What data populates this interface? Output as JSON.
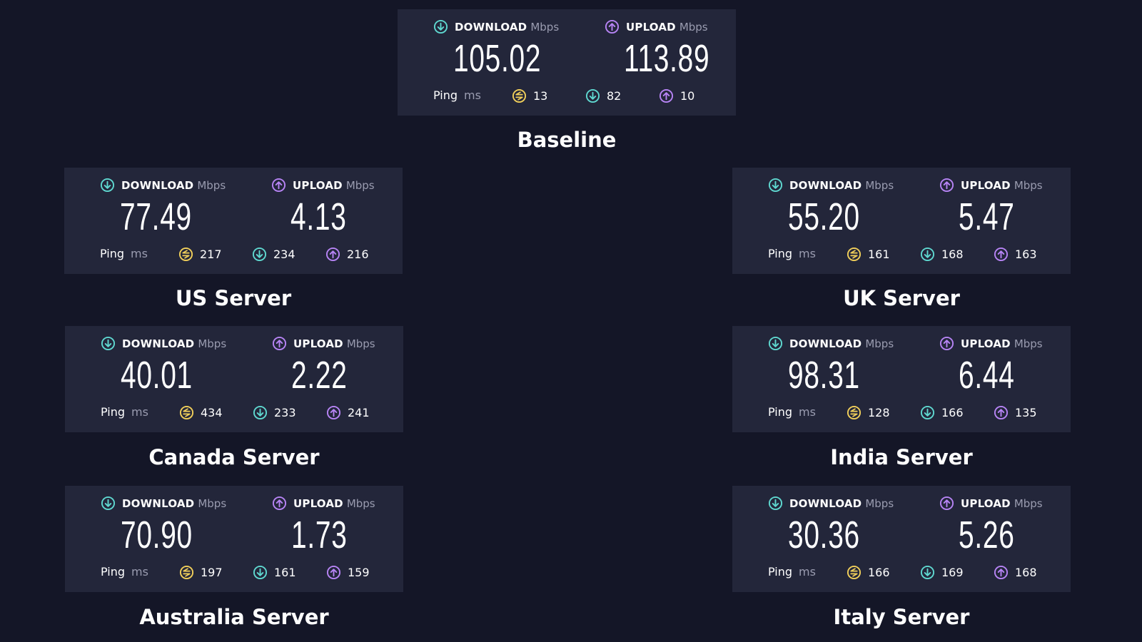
{
  "colors": {
    "background": "#141627",
    "panel": "#23263a",
    "download_accent": "#5fd8d0",
    "upload_accent": "#b784f5",
    "ping_accent": "#f1cf5a",
    "muted_text": "#9a9cb0"
  },
  "labels": {
    "download": "DOWNLOAD",
    "upload": "UPLOAD",
    "speed_unit": "Mbps",
    "ping": "Ping",
    "ping_unit": "ms"
  },
  "icons": {
    "download": "arrow-down-circle-icon",
    "upload": "arrow-up-circle-icon",
    "ping": "ping-idle-icon"
  },
  "tests": {
    "baseline": {
      "caption": "Baseline",
      "download": "105.02",
      "upload": "113.89",
      "ping_idle": "13",
      "ping_download": "82",
      "ping_upload": "10"
    },
    "us": {
      "caption": "US Server",
      "download": "77.49",
      "upload": "4.13",
      "ping_idle": "217",
      "ping_download": "234",
      "ping_upload": "216"
    },
    "uk": {
      "caption": "UK Server",
      "download": "55.20",
      "upload": "5.47",
      "ping_idle": "161",
      "ping_download": "168",
      "ping_upload": "163"
    },
    "canada": {
      "caption": "Canada Server",
      "download": "40.01",
      "upload": "2.22",
      "ping_idle": "434",
      "ping_download": "233",
      "ping_upload": "241"
    },
    "india": {
      "caption": "India Server",
      "download": "98.31",
      "upload": "6.44",
      "ping_idle": "128",
      "ping_download": "166",
      "ping_upload": "135"
    },
    "australia": {
      "caption": "Australia Server",
      "download": "70.90",
      "upload": "1.73",
      "ping_idle": "197",
      "ping_download": "161",
      "ping_upload": "159"
    },
    "italy": {
      "caption": "Italy Server",
      "download": "30.36",
      "upload": "5.26",
      "ping_idle": "166",
      "ping_download": "169",
      "ping_upload": "168"
    }
  }
}
